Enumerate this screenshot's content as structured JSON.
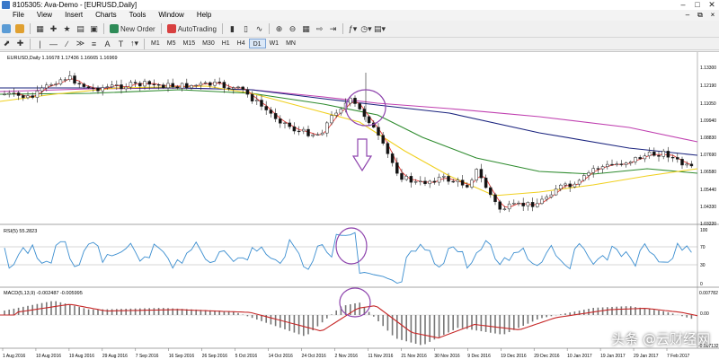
{
  "window": {
    "title": "8105305: Ava-Demo - [EURUSD,Daily]",
    "minimize_icon": "minimize-icon",
    "maximize_icon": "maximize-icon",
    "close_icon": "close-icon"
  },
  "menu": {
    "items": [
      "File",
      "View",
      "Insert",
      "Charts",
      "Tools",
      "Window",
      "Help"
    ]
  },
  "toolbar": {
    "new_order_label": "New Order",
    "autotrading_label": "AutoTrading"
  },
  "timeframes": [
    "M1",
    "M5",
    "M15",
    "M30",
    "H1",
    "H4",
    "D1",
    "W1",
    "MN"
  ],
  "active_timeframe": "D1",
  "main_chart": {
    "header": "EURUSD,Daily  1.16678 1.17436 1.16665 1.16969",
    "price_labels": [
      "1.13300",
      "1.12190",
      "1.11050",
      "1.09940",
      "1.08830",
      "1.07690",
      "1.06580",
      "1.05440",
      "1.04330",
      "1.03220"
    ]
  },
  "rsi_panel": {
    "header": "RSI(5) 55.2823",
    "levels": [
      "100",
      "70",
      "30",
      "0"
    ]
  },
  "macd_panel": {
    "header": "MACD(5,13,9) -0.002487 -0.005995",
    "labels": [
      "0.007782",
      "0.00",
      "-0.007132"
    ]
  },
  "date_labels": [
    "1 Aug 2016",
    "10 Aug 2016",
    "19 Aug 2016",
    "29 Aug 2016",
    "7 Sep 2016",
    "16 Sep 2016",
    "26 Sep 2016",
    "5 Oct 2016",
    "14 Oct 2016",
    "24 Oct 2016",
    "2 Nov 2016",
    "11 Nov 2016",
    "21 Nov 2016",
    "30 Nov 2016",
    "9 Dec 2016",
    "19 Dec 2016",
    "29 Dec 2016",
    "10 Jan 2017",
    "19 Jan 2017",
    "29 Jan 2017",
    "7 Feb 2017"
  ],
  "watermark": "头条 @云财经网",
  "colors": {
    "ma_purple": "#c040b0",
    "ma_navy": "#1a237e",
    "ma_green": "#2e8b2e",
    "ma_yellow": "#f0d020",
    "price_red": "#e53935",
    "rsi_line": "#3b8ed0",
    "macd_signal": "#c62828",
    "annotation": "#8e44ad"
  }
}
